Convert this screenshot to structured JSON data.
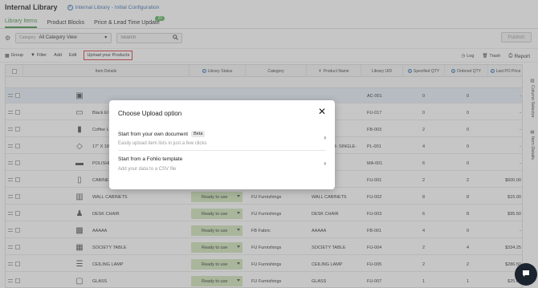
{
  "header": {
    "title": "Internal Library",
    "breadcrumb": "Internal Library - Initial Configuration"
  },
  "tabs": [
    {
      "label": "Library Items",
      "active": true
    },
    {
      "label": "Product Blocks",
      "active": false
    },
    {
      "label": "Price & Lead Time Update",
      "badge": "20",
      "active": false
    }
  ],
  "filter": {
    "category_prefix": "Category",
    "category_value": "All Category View",
    "search_placeholder": "Search"
  },
  "publish_label": "Publish",
  "toolbar": {
    "group": "Group",
    "filter": "Filter",
    "add": "Add",
    "edit": "Edit",
    "upload": "Upload your Products",
    "log": "Log",
    "trash": "Trash",
    "report": "Report"
  },
  "columns": {
    "item_details": "Item Details",
    "library_status": "Library Status",
    "category": "Category",
    "product_name": "Product Name",
    "library_uid": "Library UID",
    "specified_qty": "Specified QTY",
    "ordered_qty": "Ordered QTY",
    "last_po_price": "Last PO Price"
  },
  "side_tabs": {
    "column_selector": "Column Selector",
    "item_details": "Item Details"
  },
  "rows": [
    {
      "name": "",
      "status": "",
      "category": "",
      "product": "",
      "uid": "AC-001",
      "spec": "0",
      "ord": "0",
      "price": "-"
    },
    {
      "name": "Black El",
      "status": "",
      "category": "",
      "product": "",
      "uid": "FU-017",
      "spec": "0",
      "ord": "0",
      "price": "-"
    },
    {
      "name": "Coffee L",
      "status": "",
      "category": "",
      "product": "",
      "uid": "FB-003",
      "spec": "2",
      "ord": "0",
      "price": "-"
    },
    {
      "name": "17\" X 18\" SINGLE-",
      "status": "",
      "category": "",
      "product": "\" X 8- NDER- SINGLE-",
      "uid": "PL-001",
      "spec": "4",
      "ord": "0",
      "price": "-"
    },
    {
      "name": "POLISHE",
      "status": "",
      "category": "",
      "product": "",
      "uid": "MA-001",
      "spec": "6",
      "ord": "0",
      "price": "-"
    },
    {
      "name": "CABINET",
      "status": "",
      "category": "",
      "product": "BIN",
      "uid": "FU-001",
      "spec": "2",
      "ord": "2",
      "price": "$600.00"
    },
    {
      "name": "WALL CABINETS",
      "status": "Ready to use",
      "category": "FU Furnishings",
      "product": "WALL CABINETS",
      "uid": "FU-002",
      "spec": "8",
      "ord": "8",
      "price": "$15.00"
    },
    {
      "name": "DESK CHAIR",
      "status": "Ready to use",
      "category": "FU Furnishings",
      "product": "DESK CHAIR",
      "uid": "FU-003",
      "spec": "6",
      "ord": "8",
      "price": "$95.50"
    },
    {
      "name": "AAAAA",
      "status": "Ready to use",
      "category": "FB Fabric",
      "product": "AAAAA",
      "uid": "FB-001",
      "spec": "4",
      "ord": "0",
      "price": "-"
    },
    {
      "name": "SOCIETY TABLE",
      "status": "Ready to use",
      "category": "FU Furnishings",
      "product": "SOCIETY TABLE",
      "uid": "FU-004",
      "spec": "2",
      "ord": "4",
      "price": "$334.25"
    },
    {
      "name": "CEILING LAMP",
      "status": "Ready to use",
      "category": "FU Furnishings",
      "product": "CEILING LAMP",
      "uid": "FU-005",
      "spec": "2",
      "ord": "2",
      "price": "$286.50"
    },
    {
      "name": "GLASS",
      "status": "Ready to use",
      "category": "FU Furnishings",
      "product": "GLASS",
      "uid": "FU-007",
      "spec": "1",
      "ord": "1",
      "price": "$25.00"
    }
  ],
  "modal": {
    "title": "Choose Upload option",
    "option1_title": "Start from your own document",
    "option1_badge": "Beta",
    "option1_sub": "Easily upload item lists in just a few clicks",
    "option2_title": "Start from a Fohlio template",
    "option2_sub": "Add your data to a CSV file"
  },
  "colors": {
    "accent_green": "#3b8a3b",
    "status_green": "#cde3b6",
    "link_blue": "#2a6bb0",
    "highlight_red": "#d32f2f"
  }
}
